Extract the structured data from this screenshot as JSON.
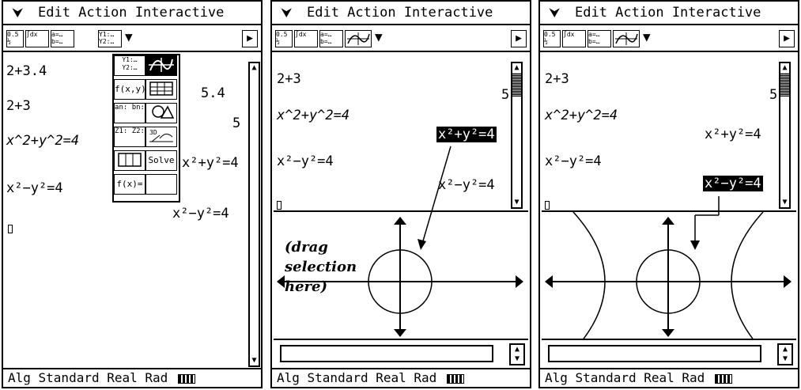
{
  "menubar": {
    "chevron": "⮟",
    "text": "Edit Action Interactive"
  },
  "toolbar": {
    "btn1": "0.5 ½",
    "btn2": "∫dx",
    "btn3": "a=… b=…",
    "btn4": "Y1:… Y2:…",
    "scroll": "▶"
  },
  "status": "Alg   Standard Real Rad",
  "screen1": {
    "lines": [
      "2+3.4",
      "5.4",
      "2+3",
      "5",
      "x^2+y^2=4",
      "x²+y²=4",
      "x²−y²=4",
      "x²−y²=4"
    ],
    "menu": {
      "items": [
        "Y1:… Y2:…",
        "graph-icon",
        "f(x,y)",
        "table-icon",
        "an: bn:",
        "geometry-icon",
        "Z1: Z2:",
        "3D-icon",
        "list-icon",
        "Solve",
        "f(x)=",
        ""
      ]
    }
  },
  "screen2": {
    "lines": [
      "2+3",
      "5",
      "x^2+y^2=4",
      "x²+y²=4",
      "x²−y²=4",
      "x²−y²=4"
    ],
    "annotation": "(drag\nselection\nhere)"
  },
  "screen3": {
    "lines": [
      "2+3",
      "5",
      "x^2+y^2=4",
      "x²+y²=4",
      "x²−y²=4",
      "x²−y²=4"
    ]
  }
}
